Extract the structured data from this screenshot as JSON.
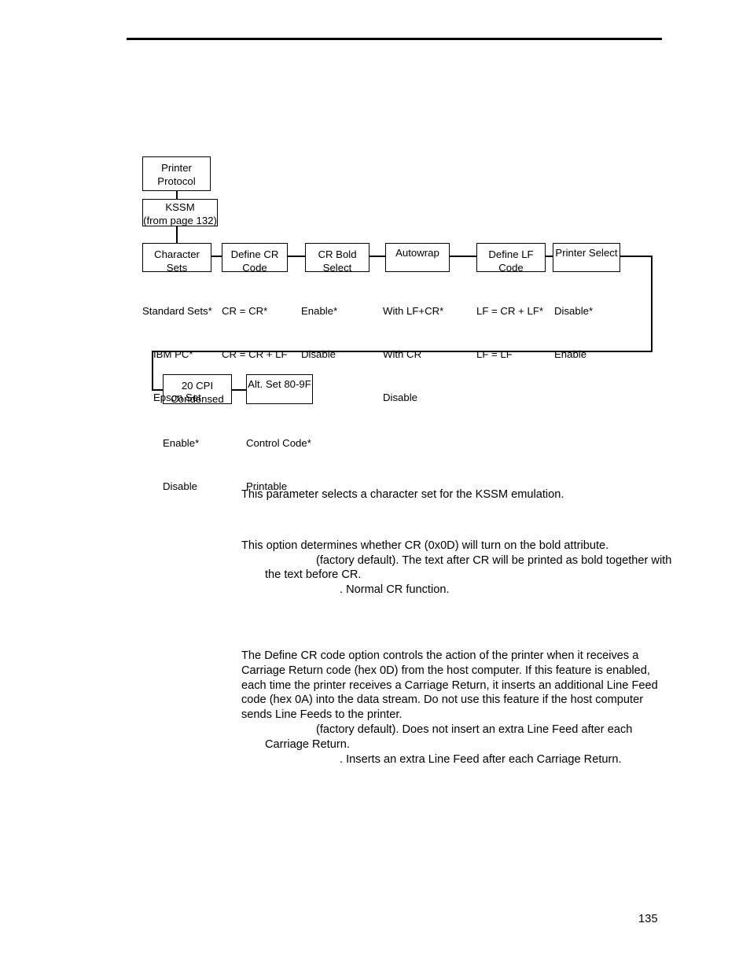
{
  "page": {
    "number": "135",
    "header_rule": true
  },
  "diagram": {
    "nodes": [
      {
        "name": "printer-protocol",
        "line1": "Printer",
        "line2": "Protocol"
      },
      {
        "name": "kssm",
        "line1": "KSSM",
        "line2": "(from page 132)"
      },
      {
        "name": "character-sets",
        "line1": "Character",
        "line2": "Sets"
      },
      {
        "name": "define-cr-code",
        "line1": "Define CR",
        "line2": "Code"
      },
      {
        "name": "cr-bold-select",
        "line1": "CR Bold",
        "line2": "Select"
      },
      {
        "name": "autowrap",
        "line1": "Autowrap",
        "line2": ""
      },
      {
        "name": "define-lf-code",
        "line1": "Define LF",
        "line2": "Code"
      },
      {
        "name": "printer-select",
        "line1": "Printer Select",
        "line2": ""
      },
      {
        "name": "20-cpi-condensed",
        "line1": "20 CPI",
        "line2": "Condensed"
      },
      {
        "name": "alt-set-80-9f",
        "line1": "Alt. Set 80-9F",
        "line2": ""
      }
    ],
    "options": {
      "character_sets": [
        "Standard Sets*",
        "IBM PC*",
        "Epson Set"
      ],
      "define_cr_code": [
        "CR = CR*",
        "CR = CR + LF"
      ],
      "cr_bold_select": [
        "Enable*",
        "Disable"
      ],
      "autowrap": [
        "With LF+CR*",
        "With CR",
        "Disable"
      ],
      "define_lf_code": [
        "LF = CR + LF*",
        "LF = LF"
      ],
      "printer_select": [
        "Disable*",
        "Enable"
      ],
      "cpi_condensed": [
        "Enable*",
        "Disable"
      ],
      "alt_set": [
        "Control Code*",
        "Printable"
      ]
    }
  },
  "content": {
    "character_sets_desc": "This parameter selects a character set for the KSSM emulation.",
    "cr_bold_desc": "This option determines whether CR (0x0D) will turn on the bold attribute.",
    "cr_bold_enable": "(factory default). The text after CR will be printed as bold together with the text before CR.",
    "cr_bold_disable": ". Normal CR function.",
    "define_cr_desc": "The Define CR code option controls the action of the printer when it receives a Carriage Return code (hex 0D) from the host computer. If this feature is enabled, each time the printer receives a Carriage Return, it inserts an additional Line Feed code (hex 0A) into the data stream. Do not use this feature if the host computer sends Line Feeds to the printer.",
    "define_cr_default": "(factory default). Does not insert an extra Line Feed after each Carriage Return.",
    "define_cr_alt": ". Inserts an extra Line Feed after each Carriage Return."
  }
}
